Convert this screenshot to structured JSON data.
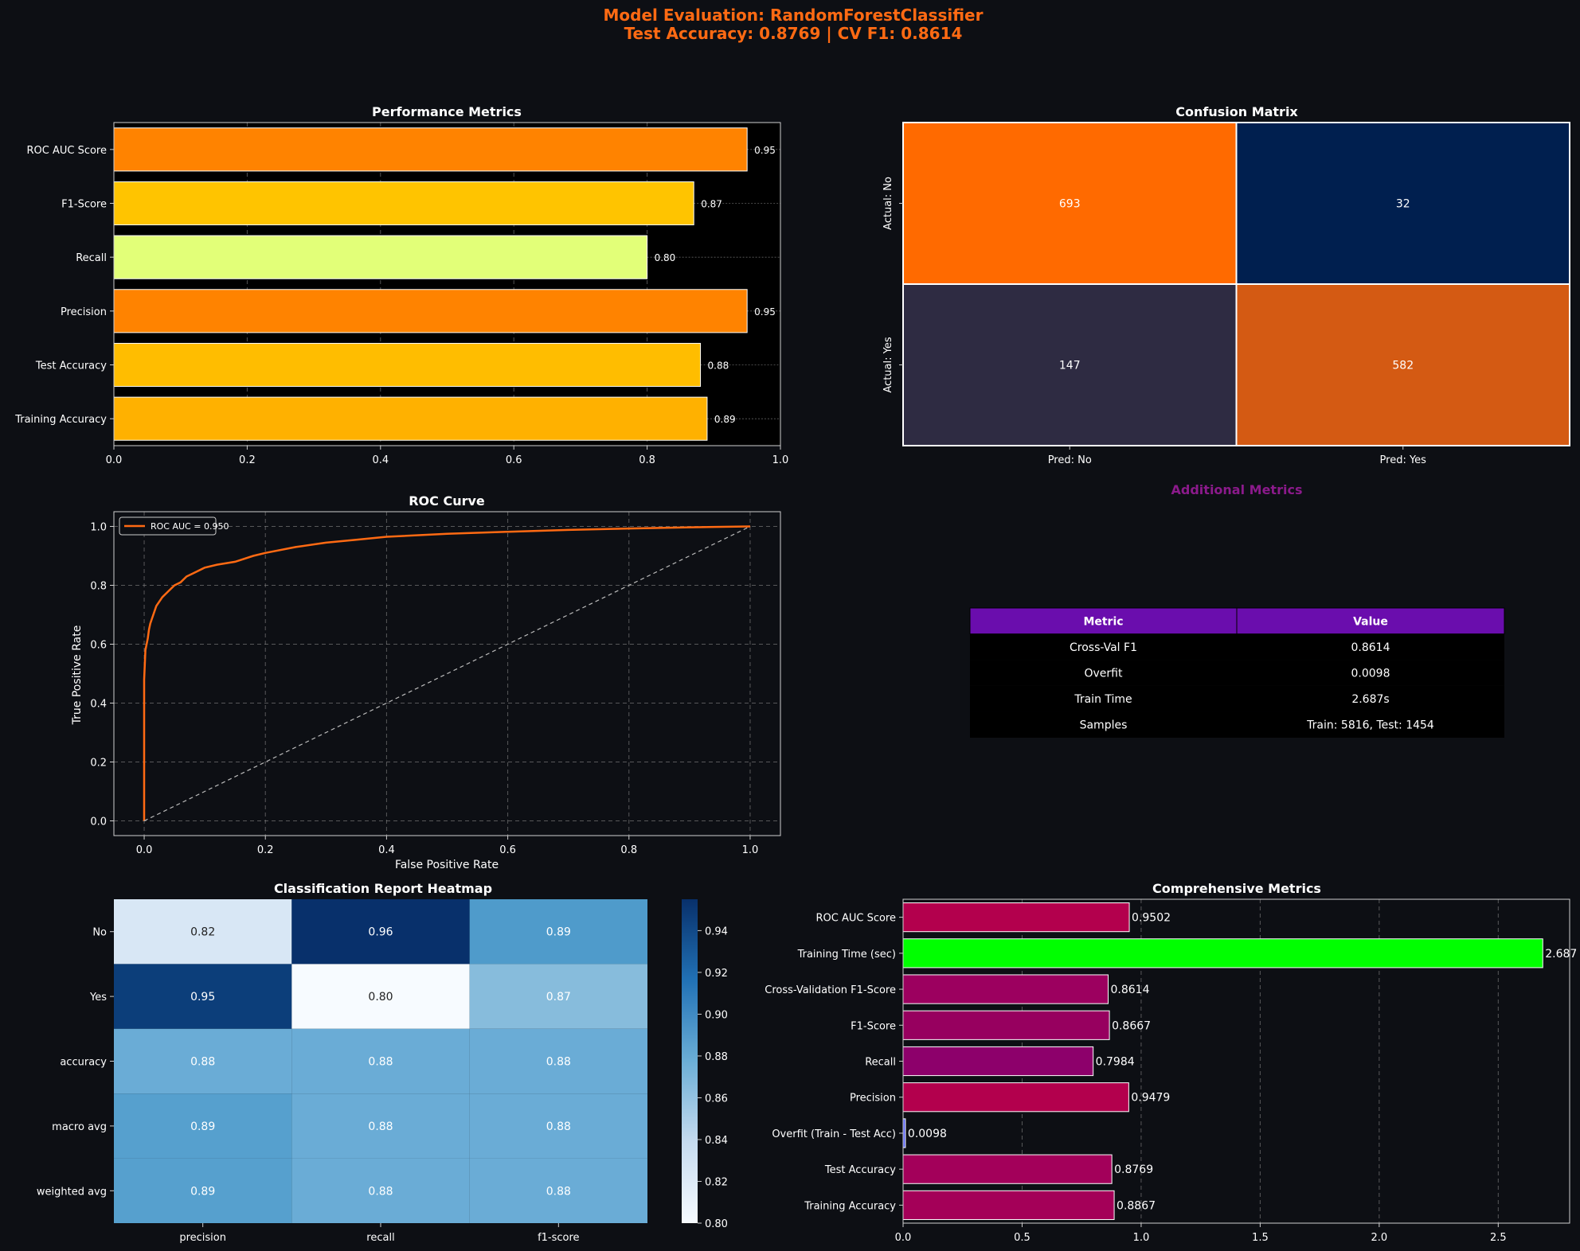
{
  "figure": {
    "title_line1": "Model Evaluation: RandomForestClassifier",
    "title_line2": "Test Accuracy: 0.8769 | CV F1: 0.8614",
    "title_color": "#ff6a13",
    "background": "#0d0f14"
  },
  "chart_data": [
    {
      "id": "performance",
      "type": "bar",
      "orientation": "horizontal",
      "title": "Performance Metrics",
      "categories": [
        "ROC AUC Score",
        "F1-Score",
        "Recall",
        "Precision",
        "Test Accuracy",
        "Training Accuracy"
      ],
      "values": [
        0.95,
        0.87,
        0.8,
        0.95,
        0.88,
        0.89
      ],
      "value_labels": [
        "0.95",
        "0.87",
        "0.80",
        "0.95",
        "0.88",
        "0.89"
      ],
      "colors": [
        "#ff8300",
        "#ffc400",
        "#e2ff78",
        "#ff8300",
        "#ffbd00",
        "#ffb100"
      ],
      "xlim": [
        0,
        1.0
      ],
      "xticks": [
        "0.0",
        "0.2",
        "0.4",
        "0.6",
        "0.8",
        "1.0"
      ],
      "grid": true
    },
    {
      "id": "confusion",
      "type": "heatmap",
      "title": "Confusion Matrix",
      "rows": [
        "Actual: No",
        "Actual: Yes"
      ],
      "cols": [
        "Pred: No",
        "Pred: Yes"
      ],
      "values": [
        [
          693,
          32
        ],
        [
          147,
          582
        ]
      ],
      "labels": [
        [
          "693",
          "32"
        ],
        [
          "147",
          "582"
        ]
      ],
      "colors": [
        [
          "#ff6a00",
          "#001f4f"
        ],
        [
          "#2e2b42",
          "#d45a13"
        ]
      ]
    },
    {
      "id": "roc",
      "type": "line",
      "title": "ROC Curve",
      "xlabel": "False Positive Rate",
      "ylabel": "True Positive Rate",
      "xlim": [
        -0.05,
        1.05
      ],
      "ylim": [
        -0.05,
        1.05
      ],
      "xticks": [
        "0.0",
        "0.2",
        "0.4",
        "0.6",
        "0.8",
        "1.0"
      ],
      "yticks": [
        "0.0",
        "0.2",
        "0.4",
        "0.6",
        "0.8",
        "1.0"
      ],
      "legend": "ROC AUC = 0.950",
      "legend_position": "top-left",
      "grid": true,
      "series": [
        {
          "name": "ROC AUC = 0.950",
          "color": "#ff6a13",
          "x": [
            0,
            0,
            0.002,
            0.004,
            0.006,
            0.008,
            0.01,
            0.015,
            0.02,
            0.03,
            0.04,
            0.05,
            0.06,
            0.07,
            0.08,
            0.1,
            0.12,
            0.15,
            0.18,
            0.2,
            0.25,
            0.3,
            0.35,
            0.4,
            0.5,
            0.6,
            0.7,
            0.8,
            0.9,
            1.0
          ],
          "y": [
            0,
            0.48,
            0.58,
            0.6,
            0.62,
            0.65,
            0.67,
            0.7,
            0.73,
            0.76,
            0.78,
            0.8,
            0.81,
            0.83,
            0.84,
            0.86,
            0.87,
            0.88,
            0.9,
            0.91,
            0.93,
            0.945,
            0.955,
            0.965,
            0.975,
            0.982,
            0.988,
            0.993,
            0.997,
            1.0
          ]
        },
        {
          "name": "",
          "color": "#bbbbbb",
          "dashed": true,
          "x": [
            0,
            1
          ],
          "y": [
            0,
            1
          ]
        }
      ]
    },
    {
      "id": "additional",
      "type": "table",
      "title": "Additional Metrics",
      "title_color": "#8b1a8b",
      "header_color": "#6a0dad",
      "columns": [
        "Metric",
        "Value"
      ],
      "rows": [
        [
          "Cross-Val F1",
          "0.8614"
        ],
        [
          "Overfit",
          "0.0098"
        ],
        [
          "Train Time",
          "2.687s"
        ],
        [
          "Samples",
          "Train: 5816, Test: 1454"
        ]
      ]
    },
    {
      "id": "report",
      "type": "heatmap",
      "title": "Classification Report Heatmap",
      "rows": [
        "No",
        "Yes",
        "accuracy",
        "macro avg",
        "weighted avg"
      ],
      "cols": [
        "precision",
        "recall",
        "f1-score"
      ],
      "values": [
        [
          0.82,
          0.96,
          0.89
        ],
        [
          0.95,
          0.8,
          0.87
        ],
        [
          0.88,
          0.88,
          0.88
        ],
        [
          0.89,
          0.88,
          0.88
        ],
        [
          0.89,
          0.88,
          0.88
        ]
      ],
      "labels": [
        [
          "0.82",
          "0.96",
          "0.89"
        ],
        [
          "0.95",
          "0.80",
          "0.87"
        ],
        [
          "0.88",
          "0.88",
          "0.88"
        ],
        [
          "0.89",
          "0.88",
          "0.88"
        ],
        [
          "0.89",
          "0.88",
          "0.88"
        ]
      ],
      "colors": [
        [
          "#d8e7f5",
          "#08306b",
          "#4f9bcb"
        ],
        [
          "#0c3e7a",
          "#f7fbff",
          "#87bcdc"
        ],
        [
          "#6aacd6",
          "#6aacd6",
          "#6aacd6"
        ],
        [
          "#56a0ce",
          "#6aacd6",
          "#6aacd6"
        ],
        [
          "#56a0ce",
          "#6aacd6",
          "#6aacd6"
        ]
      ],
      "colorbar": {
        "min": 0.8,
        "max": 0.955,
        "ticks": [
          "0.80",
          "0.82",
          "0.84",
          "0.86",
          "0.88",
          "0.90",
          "0.92",
          "0.94"
        ],
        "tick_values": [
          0.8,
          0.82,
          0.84,
          0.86,
          0.88,
          0.9,
          0.92,
          0.94
        ],
        "colors": [
          "#f7fbff",
          "#c6dbef",
          "#6baed6",
          "#2171b5",
          "#08306b"
        ]
      }
    },
    {
      "id": "comprehensive",
      "type": "bar",
      "orientation": "horizontal",
      "title": "Comprehensive Metrics",
      "categories": [
        "ROC AUC Score",
        "Training Time (sec)",
        "Cross-Validation F1-Score",
        "F1-Score",
        "Recall",
        "Precision",
        "Overfit (Train - Test Acc)",
        "Test Accuracy",
        "Training Accuracy"
      ],
      "values": [
        0.9502,
        2.687,
        0.8614,
        0.8667,
        0.7984,
        0.9479,
        0.0098,
        0.8769,
        0.8867
      ],
      "value_labels": [
        "0.9502",
        "2.687",
        "0.8614",
        "0.8667",
        "0.7984",
        "0.9479",
        "0.0098",
        "0.8769",
        "0.8867"
      ],
      "colors": [
        "#b3004d",
        "#00ff00",
        "#9c005f",
        "#97005f",
        "#8d006b",
        "#b3004d",
        "#5560ff",
        "#a3005a",
        "#a40058"
      ],
      "xlim": [
        0,
        2.8
      ],
      "xticks": [
        "0.0",
        "0.5",
        "1.0",
        "1.5",
        "2.0",
        "2.5"
      ],
      "xtick_values": [
        0,
        0.5,
        1.0,
        1.5,
        2.0,
        2.5
      ],
      "grid": true
    }
  ]
}
